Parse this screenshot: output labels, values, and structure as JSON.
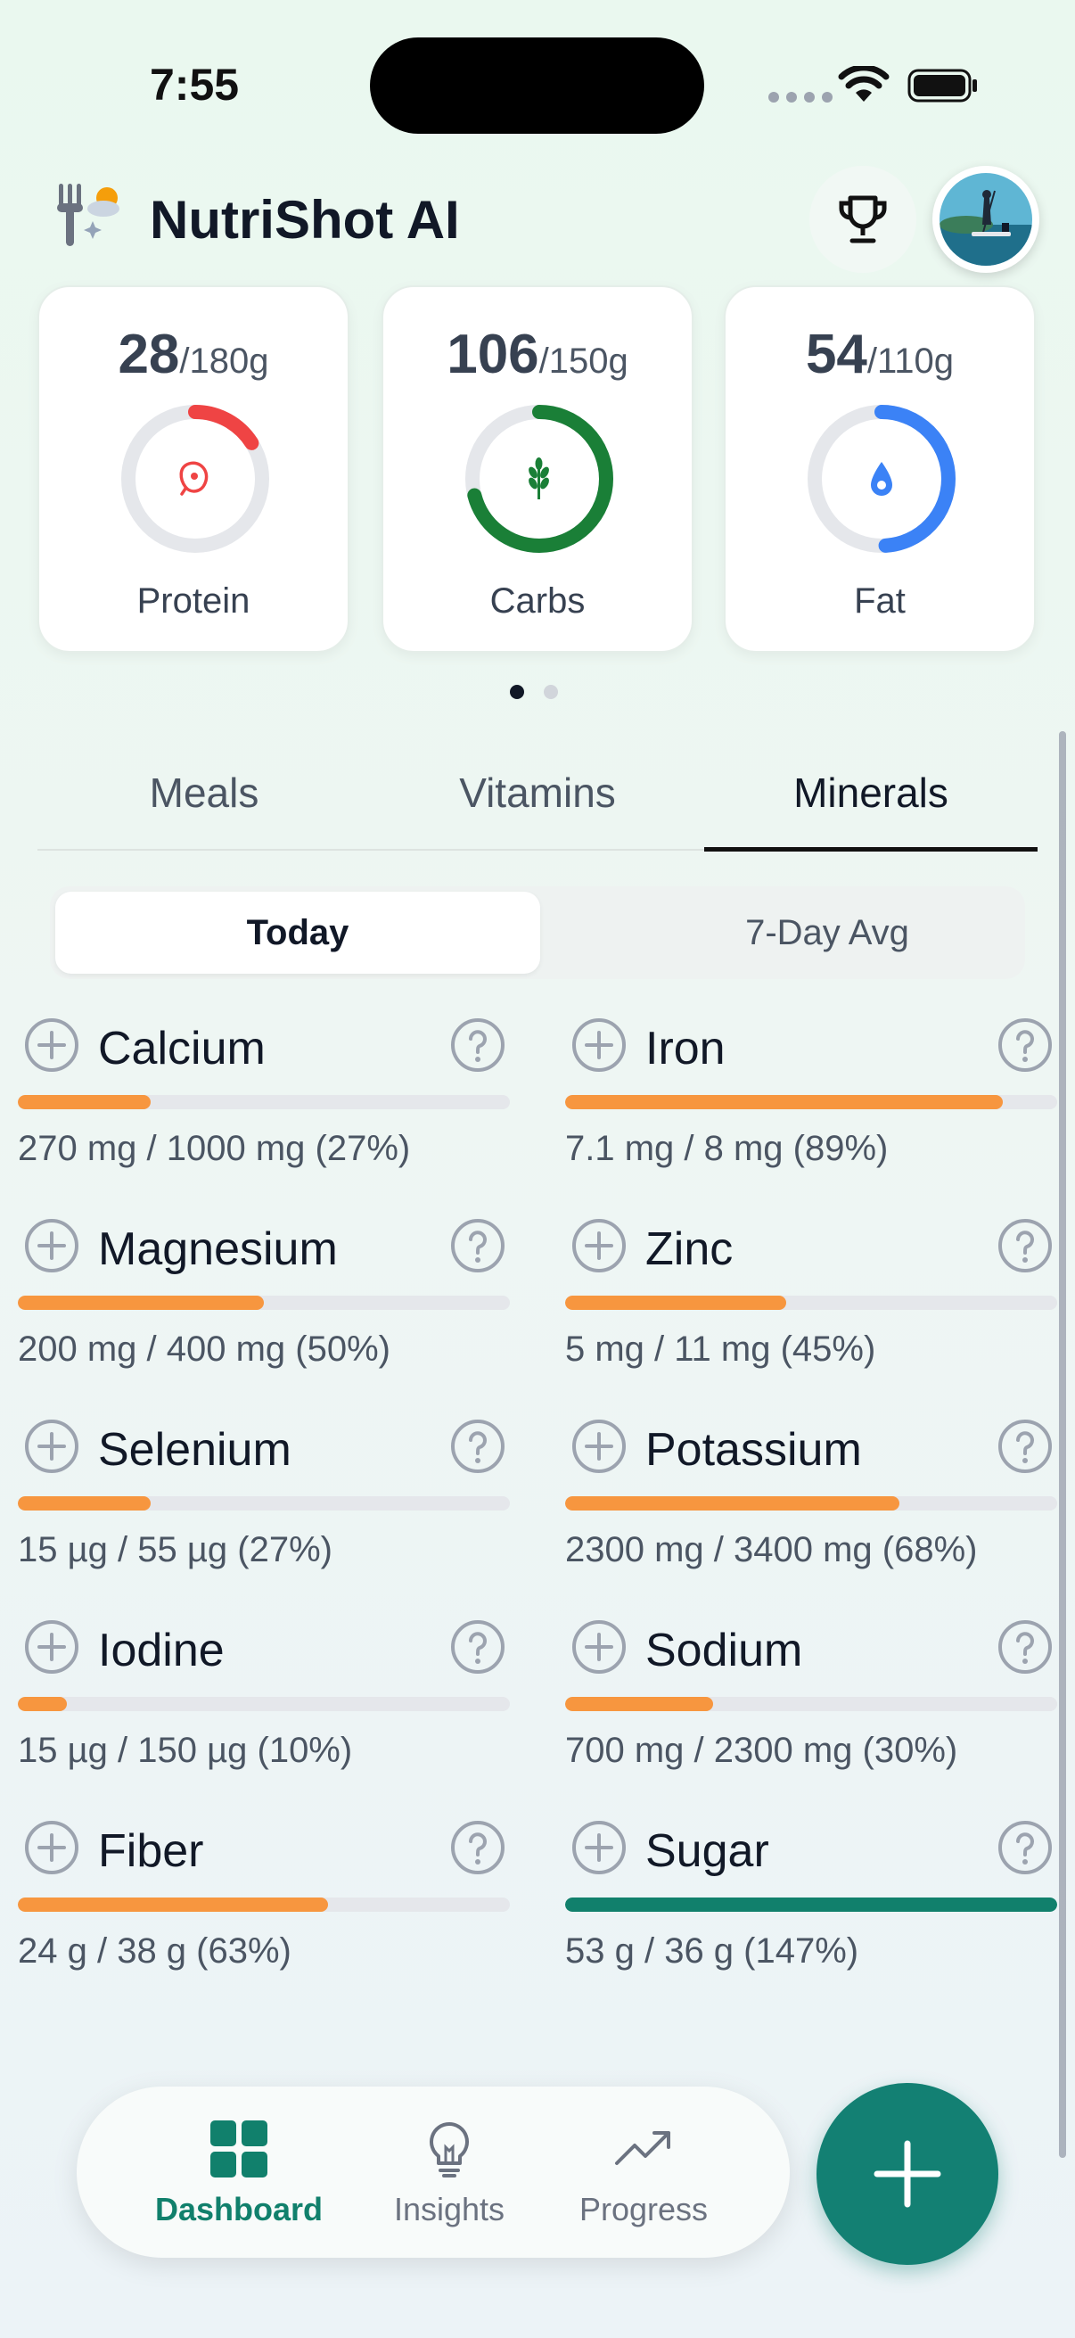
{
  "status": {
    "time": "7:55"
  },
  "header": {
    "title": "NutriShot AI"
  },
  "macros": [
    {
      "value": "28",
      "goal": "/180g",
      "label": "Protein",
      "progress": 0.16,
      "color": "#ef4444"
    },
    {
      "value": "106",
      "goal": "/150g",
      "label": "Carbs",
      "progress": 0.71,
      "color": "#1a7f37"
    },
    {
      "value": "54",
      "goal": "/110g",
      "label": "Fat",
      "progress": 0.49,
      "color": "#3b82f6"
    }
  ],
  "tabs": [
    "Meals",
    "Vitamins",
    "Minerals"
  ],
  "segmented": {
    "today": "Today",
    "avg": "7-Day Avg"
  },
  "minerals": [
    {
      "name": "Calcium",
      "detail": "270 mg / 1000 mg (27%)",
      "progress": 0.27
    },
    {
      "name": "Iron",
      "detail": "7.1 mg / 8 mg (89%)",
      "progress": 0.89
    },
    {
      "name": "Magnesium",
      "detail": "200 mg / 400 mg (50%)",
      "progress": 0.5
    },
    {
      "name": "Zinc",
      "detail": "5 mg / 11 mg (45%)",
      "progress": 0.45
    },
    {
      "name": "Selenium",
      "detail": "15 µg / 55 µg (27%)",
      "progress": 0.27
    },
    {
      "name": "Potassium",
      "detail": "2300 mg / 3400 mg (68%)",
      "progress": 0.68
    },
    {
      "name": "Iodine",
      "detail": "15 µg / 150 µg (10%)",
      "progress": 0.1
    },
    {
      "name": "Sodium",
      "detail": "700 mg / 2300 mg (30%)",
      "progress": 0.3
    },
    {
      "name": "Fiber",
      "detail": "24 g / 38 g (63%)",
      "progress": 0.63
    },
    {
      "name": "Sugar",
      "detail": "53 g / 36 g (147%)",
      "progress": 1.0,
      "over": true
    }
  ],
  "nav": {
    "dashboard": "Dashboard",
    "insights": "Insights",
    "progress": "Progress"
  }
}
